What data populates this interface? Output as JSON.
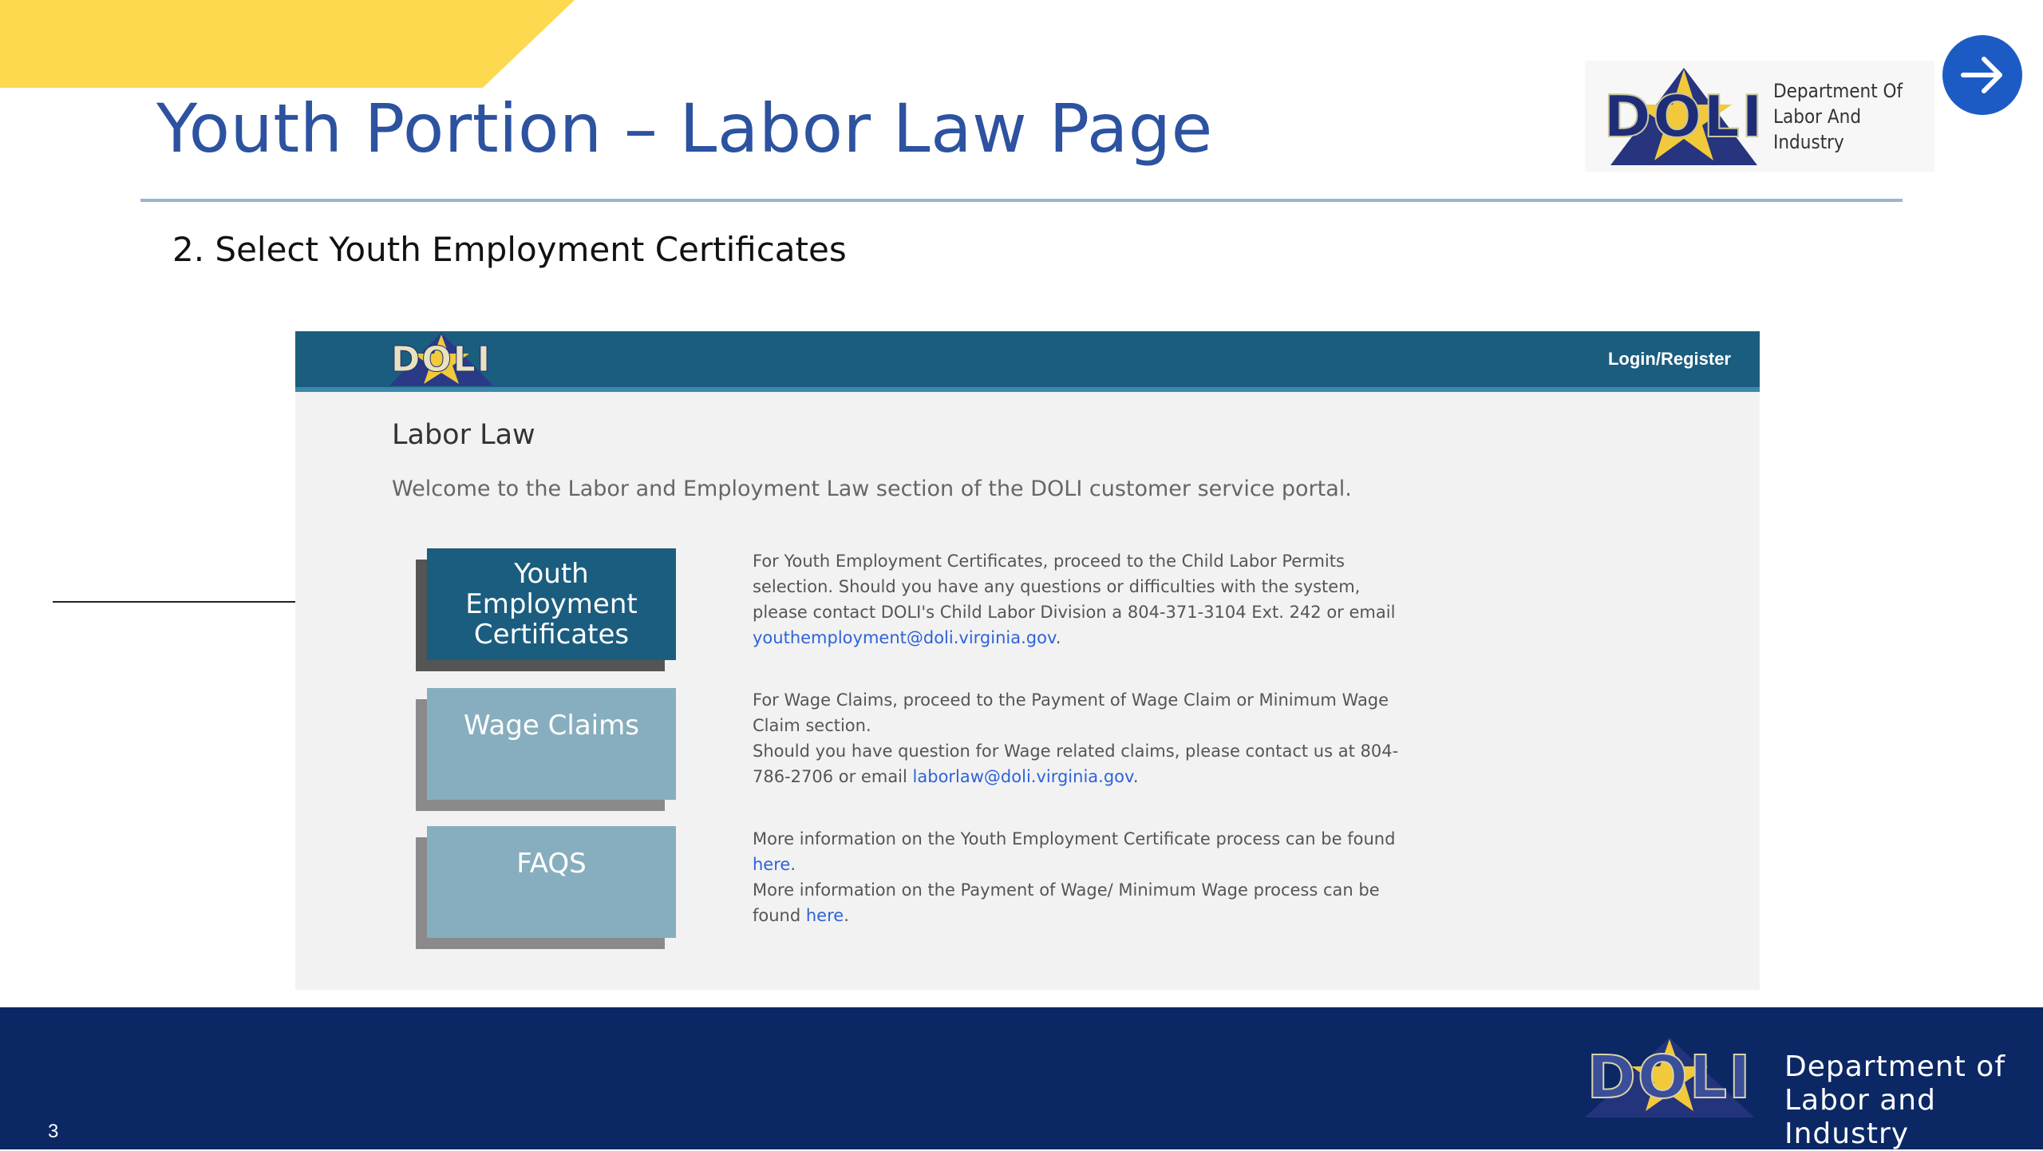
{
  "slide": {
    "title": "Youth Portion – Labor Law Page",
    "step": "2. Select Youth Employment Certificates",
    "page_number": "3"
  },
  "header_logo": {
    "mark": "DOLI",
    "caption_line1": "Department Of",
    "caption_line2": "Labor And Industry"
  },
  "next_button": {
    "icon": "arrow-right-icon",
    "color": "#1d5bc4"
  },
  "portal": {
    "nav": {
      "logo": "DOLI",
      "login": "Login/Register",
      "color": "#1b5d7f"
    },
    "heading": "Labor Law",
    "welcome": "Welcome to the Labor and Employment Law section of the DOLI customer service portal.",
    "tiles": [
      {
        "label": "Youth Employment Certificates",
        "color": "#1b5d7f"
      },
      {
        "label": "Wage Claims",
        "color": "#87aebe"
      },
      {
        "label": "FAQS",
        "color": "#87aebe"
      }
    ],
    "youth_info": {
      "text": "For Youth Employment Certificates, proceed to the Child Labor Permits selection. Should you have any questions or difficulties with the system, please contact DOLI's Child Labor Division a 804-371-3104 Ext. 242 or email ",
      "email": "youthemployment@doli.virginia.gov",
      "end": "."
    },
    "wage_info": {
      "line1": "For Wage Claims, proceed to the Payment of Wage Claim or Minimum Wage Claim section.",
      "line2": "Should you have question for Wage related claims, please contact us at 804-786-2706 or email ",
      "email": "laborlaw@doli.virginia.gov",
      "end": "."
    },
    "faq_info": {
      "line1": "More information on the Youth Employment Certificate process can be found ",
      "link1": "here",
      "end1": ".",
      "line2": "More information on the Payment of Wage/ Minimum Wage process can be found ",
      "link2": "here",
      "end2": "."
    }
  },
  "footer": {
    "mark": "DOLI",
    "dept_line1": "Department of",
    "dept_line2": "Labor and Industry",
    "color": "#0b2865"
  },
  "accent": {
    "yellow": "#fcd94e",
    "title_blue": "#2c52a0"
  }
}
